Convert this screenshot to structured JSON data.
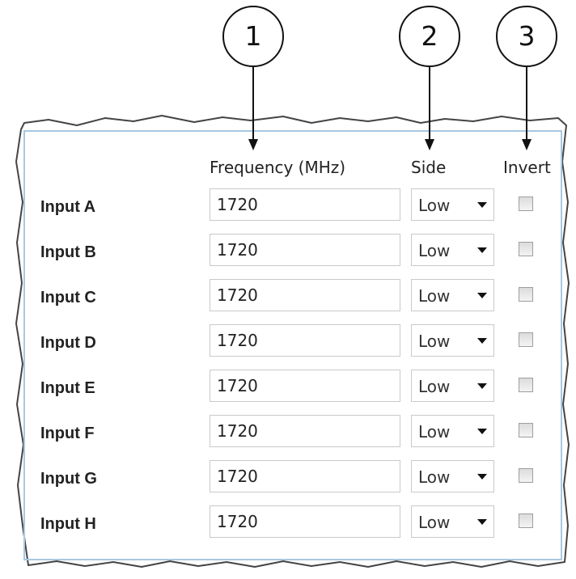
{
  "callouts": [
    "1",
    "2",
    "3"
  ],
  "table": {
    "headers": {
      "frequency": "Frequency (MHz)",
      "side": "Side",
      "invert": "Invert"
    },
    "rows": [
      {
        "label": "Input A",
        "frequency": "1720",
        "side": "Low",
        "invert": false
      },
      {
        "label": "Input B",
        "frequency": "1720",
        "side": "Low",
        "invert": false
      },
      {
        "label": "Input C",
        "frequency": "1720",
        "side": "Low",
        "invert": false
      },
      {
        "label": "Input D",
        "frequency": "1720",
        "side": "Low",
        "invert": false
      },
      {
        "label": "Input E",
        "frequency": "1720",
        "side": "Low",
        "invert": false
      },
      {
        "label": "Input F",
        "frequency": "1720",
        "side": "Low",
        "invert": false
      },
      {
        "label": "Input G",
        "frequency": "1720",
        "side": "Low",
        "invert": false
      },
      {
        "label": "Input H",
        "frequency": "1720",
        "side": "Low",
        "invert": false
      }
    ]
  },
  "colors": {
    "panel_border": "#a8c8e0",
    "input_border": "#c9c9c9",
    "background": "#ffffff"
  }
}
